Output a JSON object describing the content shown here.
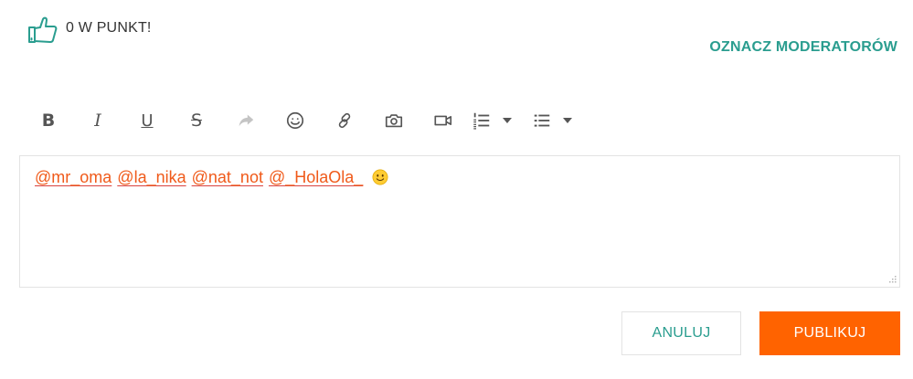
{
  "vote": {
    "icon": "thumbs-up-icon",
    "count_label": "0 W PUNKT!"
  },
  "header": {
    "mark_moderators": "OZNACZ MODERATORÓW"
  },
  "toolbar": {
    "bold": "B",
    "italic": "I",
    "underline": "U",
    "strikethrough": "S",
    "icons": [
      "redo-icon",
      "emoji-icon",
      "link-icon",
      "camera-icon",
      "video-icon",
      "ordered-list-icon",
      "bullet-list-icon"
    ]
  },
  "editor": {
    "mentions": [
      "@mr_oma",
      "@la_nika",
      "@nat_not",
      "@_HolaOla_"
    ],
    "emoji": "slightly-smiling-face-icon"
  },
  "buttons": {
    "cancel": "ANULUJ",
    "publish": "PUBLIKUJ"
  },
  "colors": {
    "accent": "#2a9d8f",
    "primary": "#ff6300",
    "mention": "#f05a1a",
    "disabled": "#c4c4c4"
  }
}
